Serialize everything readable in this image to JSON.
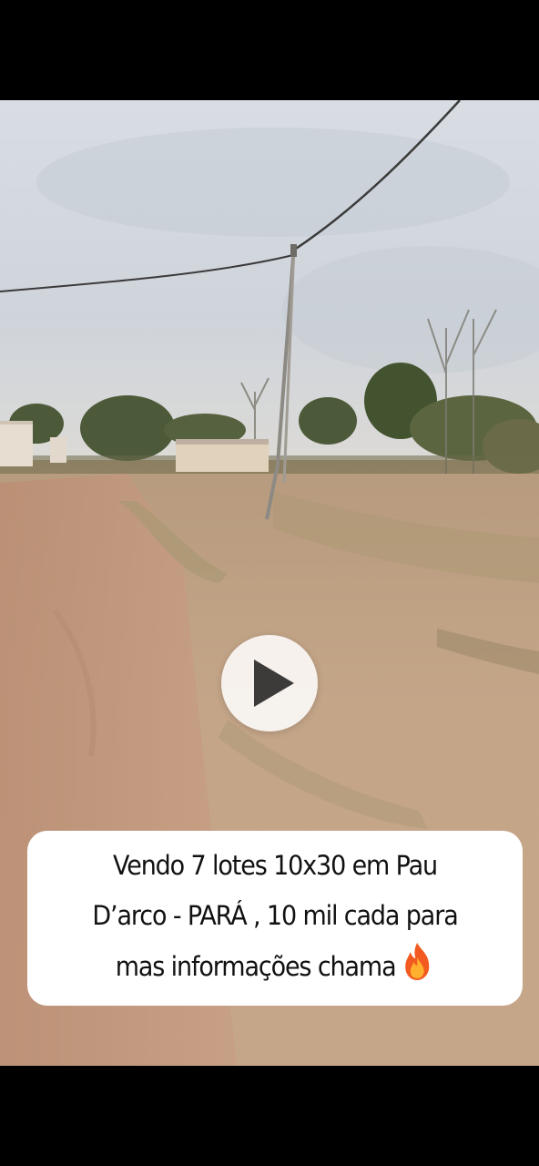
{
  "video": {
    "state": "paused",
    "play_icon": "play-icon"
  },
  "caption": {
    "line1": "Vendo 7 lotes 10x30 em Pau",
    "line2": "D’arco - PARÁ , 10 mil cada para",
    "line3": "mas informações chama",
    "emoji_icon": "fire-icon"
  },
  "colors": {
    "letterbox": "#000000",
    "caption_bg": "#ffffff",
    "caption_text": "#111111",
    "play_bg": "#f2efec",
    "play_icon": "#3d3b3a"
  }
}
